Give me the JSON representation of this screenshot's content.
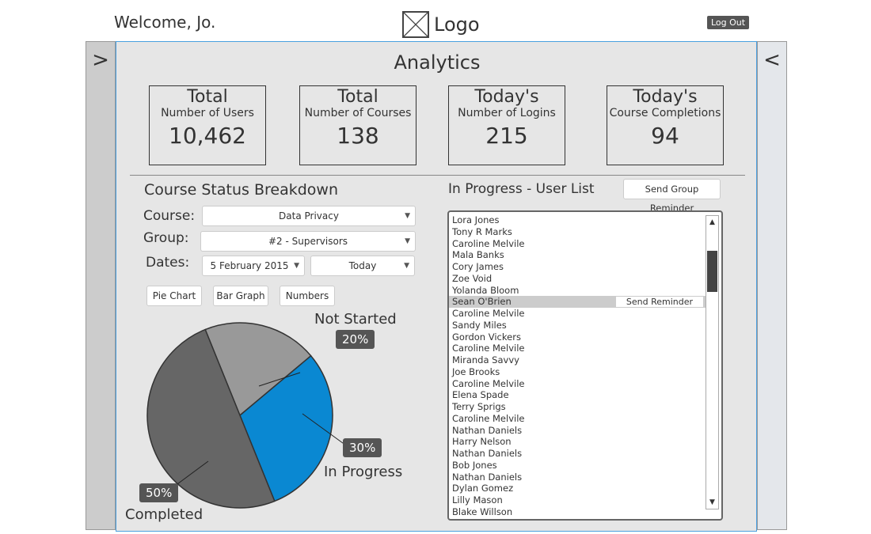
{
  "header": {
    "welcome": "Welcome, Jo.",
    "logo": "Logo",
    "logout": "Log Out"
  },
  "sidebar": {
    "left_icon": ">",
    "right_icon": "<"
  },
  "main": {
    "title": "Analytics",
    "stats": [
      {
        "title": "Total",
        "subtitle": "Number of Users",
        "value": "10,462"
      },
      {
        "title": "Total",
        "subtitle": "Number of Courses",
        "value": "138"
      },
      {
        "title": "Today's",
        "subtitle": "Number of Logins",
        "value": "215"
      },
      {
        "title": "Today's",
        "subtitle": "Course Completions",
        "value": "94"
      }
    ]
  },
  "breakdown": {
    "title": "Course Status Breakdown",
    "course_label": "Course:",
    "course_value": "Data Privacy",
    "group_label": "Group:",
    "group_value": "#2 - Supervisors",
    "dates_label": "Dates:",
    "date_from": "5 February 2015",
    "date_to": "Today",
    "buttons": [
      "Pie Chart",
      "Bar Graph",
      "Numbers"
    ]
  },
  "chart_data": {
    "type": "pie",
    "slices": [
      {
        "label": "Not Started",
        "value": 20,
        "display": "20%",
        "color": "#999999"
      },
      {
        "label": "In Progress",
        "value": 30,
        "display": "30%",
        "color": "#0a88d2"
      },
      {
        "label": "Completed",
        "value": 50,
        "display": "50%",
        "color": "#666666"
      }
    ]
  },
  "userlist": {
    "title": "In Progress - User List",
    "group_button": "Send Group Reminder",
    "row_button": "Send Reminder",
    "selected_index": 7,
    "users": [
      "Lora Jones",
      "Tony R Marks",
      "Caroline Melvile",
      "Mala Banks",
      "Cory James",
      "Zoe Void",
      "Yolanda Bloom",
      "Sean O'Brien",
      "Caroline Melvile",
      "Sandy Miles",
      "Gordon Vickers",
      "Caroline Melvile",
      "Miranda Savvy",
      "Joe Brooks",
      "Caroline Melvile",
      "Elena Spade",
      "Terry Sprigs",
      "Caroline Melvile",
      "Nathan Daniels",
      "Harry Nelson",
      "Nathan Daniels",
      "Bob Jones",
      "Nathan Daniels",
      "Dylan Gomez",
      "Lilly Mason",
      "Blake Willson"
    ]
  }
}
